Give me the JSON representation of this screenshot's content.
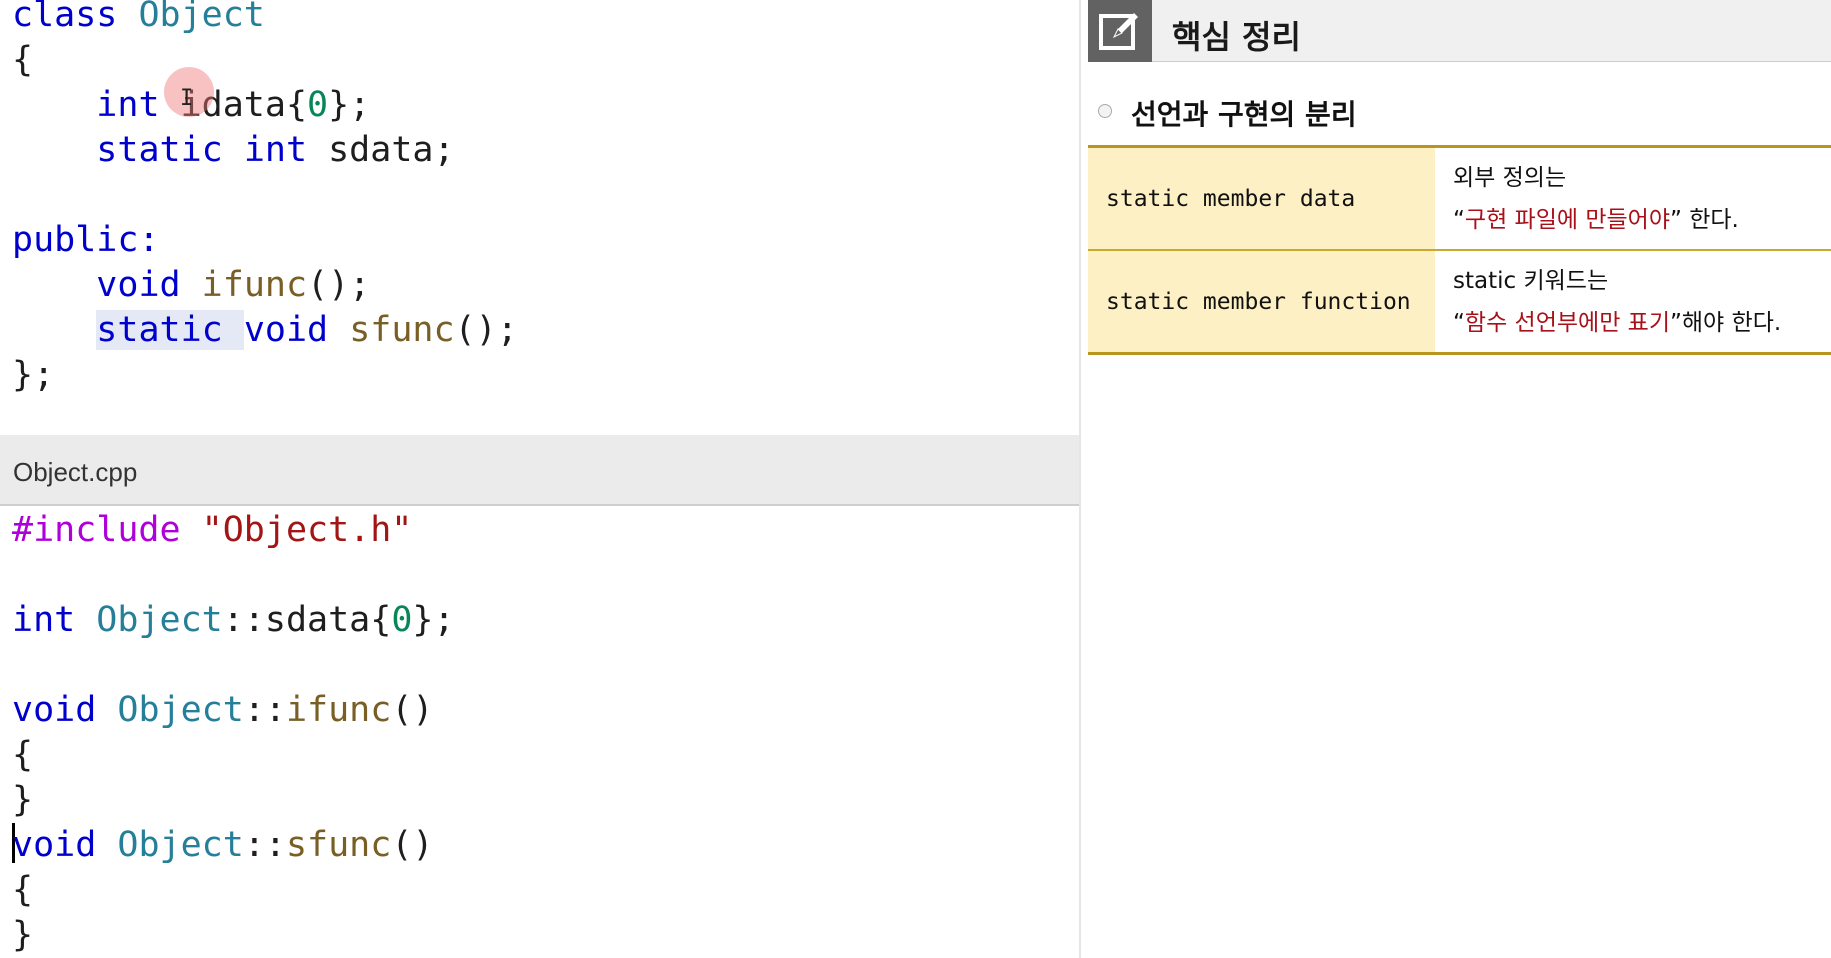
{
  "header_code": {
    "l1_kw": "class",
    "l1_name": "Object",
    "l2": "{",
    "l3_type": "int",
    "l3_rest": "idata{",
    "l3_num": "0",
    "l3_end": "};",
    "l4_kw1": "static",
    "l4_kw2": "int",
    "l4_rest": "sdata;",
    "l6_access": "public:",
    "l7_type": "void",
    "l7_fn": "ifunc",
    "l7_end": "();",
    "l8_kw": "static",
    "l8_type": "void",
    "l8_fn": "sfunc",
    "l8_end": "();",
    "l9": "};"
  },
  "file_bar": {
    "filename": "Object.cpp"
  },
  "cpp_code": {
    "l1_pp": "#include",
    "l1_str": "\"Object.h\"",
    "l3_type": "int",
    "l3_class": "Object",
    "l3_rest": "::sdata{",
    "l3_num": "0",
    "l3_end": "};",
    "l5_type": "void",
    "l5_class": "Object",
    "l5_sep": "::",
    "l5_fn": "ifunc",
    "l5_end": "()",
    "l6": "{",
    "l7": "}",
    "l8_type": "void",
    "l8_class": "Object",
    "l8_sep": "::",
    "l8_fn": "sfunc",
    "l8_end": "()",
    "l9": "{",
    "l10": "}"
  },
  "summary": {
    "title": "핵심 정리",
    "section": "선언과 구현의 분리",
    "rows": [
      {
        "key": "static member data",
        "line1": "외부 정의는",
        "line2_open": "“",
        "line2_hl": "구현 파일에 만들어야",
        "line2_close": "” 한다."
      },
      {
        "key": "static member function",
        "line1": "static 키워드는",
        "line2_open": "“",
        "line2_hl": "함수 선언부에만 표기",
        "line2_close": "”해야 한다."
      }
    ]
  },
  "colors": {
    "keyword": "#0000cc",
    "type_name": "#267f99",
    "function_name": "#795e26",
    "number": "#098658",
    "string": "#a31515",
    "preprocessor": "#af00db",
    "highlight_text": "#a8101a",
    "table_key_bg": "#fdf0c4",
    "table_border": "#b8961e"
  },
  "icons": {
    "title_icon": "edit-icon",
    "section_bullet": "bullet-icon"
  }
}
